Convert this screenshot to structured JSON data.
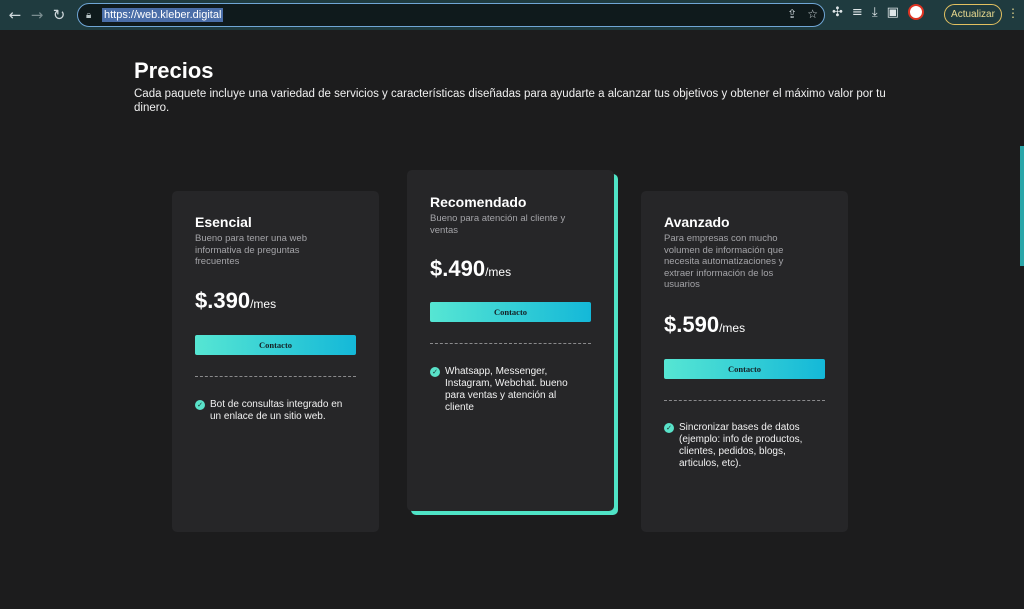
{
  "browser": {
    "url": "https://web.kleber.digital",
    "update_label": "Actualizar"
  },
  "page": {
    "title": "Precios",
    "subtitle": "Cada paquete incluye una variedad de servicios y características diseñadas para ayudarte a alcanzar tus objetivos y obtener el máximo valor por tu dinero."
  },
  "plans": [
    {
      "name": "Esencial",
      "description": "Bueno para tener una web informativa de preguntas frecuentes",
      "price": "$.390",
      "period": "/mes",
      "cta": "Contacto",
      "feature": "Bot de consultas integrado en un enlace de un sitio web."
    },
    {
      "name": "Recomendado",
      "description": "Bueno para atención al cliente y ventas",
      "price": "$.490",
      "period": "/mes",
      "cta": "Contacto",
      "feature": "Whatsapp, Messenger, Instagram, Webchat. bueno para ventas y atención al cliente"
    },
    {
      "name": "Avanzado",
      "description": "Para empresas con mucho volumen de información que necesita automatizaciones y extraer información de los usuarios",
      "price": "$.590",
      "period": "/mes",
      "cta": "Contacto",
      "feature": "Sincronizar bases de datos (ejemplo: info de productos, clientes, pedidos, blogs, articulos, etc)."
    }
  ],
  "colors": {
    "accent_start": "#56e6d3",
    "accent_end": "#14b8d8",
    "highlight_shadow": "#4fe3c6",
    "card_bg": "#262628",
    "page_bg": "#1c1c1d"
  }
}
